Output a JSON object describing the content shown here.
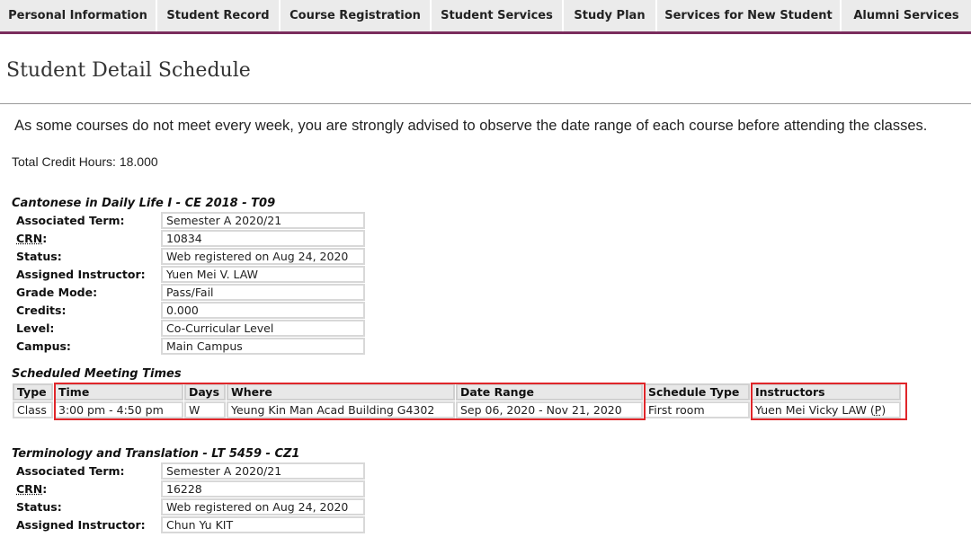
{
  "nav": {
    "tabs": [
      {
        "label": "Personal Information"
      },
      {
        "label": "Student Record"
      },
      {
        "label": "Course Registration"
      },
      {
        "label": "Student Services"
      },
      {
        "label": "Study Plan"
      },
      {
        "label": "Services for New Student"
      },
      {
        "label": "Alumni Services"
      }
    ]
  },
  "page": {
    "title": "Student Detail Schedule",
    "notice": "As some courses do not meet every week, you are strongly advised to observe the date range of each course before attending the classes.",
    "total_credit_hours": "Total Credit Hours: 18.000"
  },
  "courses": [
    {
      "caption": "Cantonese in Daily Life I - CE 2018 - T09",
      "rows": [
        {
          "label": "Associated Term:",
          "value": "Semester A 2020/21"
        },
        {
          "label": "CRN",
          "suffix": ":",
          "value": "10834"
        },
        {
          "label": "Status:",
          "value": "Web registered on Aug 24, 2020"
        },
        {
          "label": "Assigned Instructor:",
          "value": "Yuen Mei V. LAW"
        },
        {
          "label": "Grade Mode:",
          "value": "Pass/Fail"
        },
        {
          "label": "Credits:",
          "value": "0.000"
        },
        {
          "label": "Level:",
          "value": "Co-Curricular Level"
        },
        {
          "label": "Campus:",
          "value": "Main Campus"
        }
      ],
      "meeting": {
        "caption": "Scheduled Meeting Times",
        "headers": {
          "type": "Type",
          "time": "Time",
          "days": "Days",
          "where": "Where",
          "date_range": "Date Range",
          "schedule_type": "Schedule Type",
          "instructors": "Instructors"
        },
        "row": {
          "type": "Class",
          "time": "3:00 pm - 4:50 pm",
          "days": "W",
          "where": "Yeung Kin Man Acad Building G4302",
          "date_range": "Sep 06, 2020 - Nov 21, 2020",
          "schedule_type": "First room",
          "instructor_name": "Yuen Mei Vicky LAW",
          "instructor_open": "(",
          "instructor_flag": "P",
          "instructor_close": ")"
        }
      }
    },
    {
      "caption": "Terminology and Translation - LT 5459 - CZ1",
      "rows": [
        {
          "label": "Associated Term:",
          "value": "Semester A 2020/21"
        },
        {
          "label": "CRN",
          "suffix": ":",
          "value": "16228"
        },
        {
          "label": "Status:",
          "value": "Web registered on Aug 24, 2020"
        },
        {
          "label": "Assigned Instructor:",
          "value": "Chun Yu KIT"
        }
      ]
    }
  ],
  "colors": {
    "nav_bg": "#ebebeb",
    "nav_accent": "#7a2c5d",
    "highlight": "#e0262a",
    "cell_border": "#d8d8d8",
    "header_bg": "#e8e8e8"
  }
}
